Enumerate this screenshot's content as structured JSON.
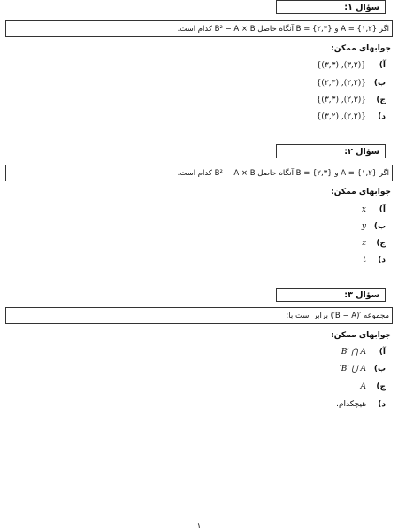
{
  "answers_label": "جوابهای ممکن:",
  "questions": [
    {
      "title": "سؤال ۱:",
      "text": "اگر A = {۱,۲} و B = {۲,۳} آنگاه حاصل B² − A × B کدام است.",
      "options": [
        {
          "letter": "آ)",
          "value": "{(۳,۲), (۳,۳)}"
        },
        {
          "letter": "ب)",
          "value": "{(۲,۲), (۲,۳)}"
        },
        {
          "letter": "ج)",
          "value": "{(۲,۳), (۳,۳)}"
        },
        {
          "letter": "د)",
          "value": "{(۲,۲), (۳,۲)}"
        }
      ]
    },
    {
      "title": "سؤال ۲:",
      "text": "اگر A = {۱,۲} و B = {۲,۳} آنگاه حاصل B² − A × B کدام است.",
      "options": [
        {
          "letter": "آ)",
          "value": "x"
        },
        {
          "letter": "ب)",
          "value": "y"
        },
        {
          "letter": "ج)",
          "value": "z"
        },
        {
          "letter": "د)",
          "value": "t"
        }
      ]
    },
    {
      "title": "سؤال ۳:",
      "text": "مجموعه ′(B − A′) برابر است با:",
      "options": [
        {
          "letter": "آ)",
          "value": "B′ ⋂ A"
        },
        {
          "letter": "ب)",
          "value": "B′ ⋃ A′"
        },
        {
          "letter": "ج)",
          "value": "A"
        },
        {
          "letter": "د)",
          "value": "هیچکدام."
        }
      ]
    }
  ],
  "page_number": "۱"
}
